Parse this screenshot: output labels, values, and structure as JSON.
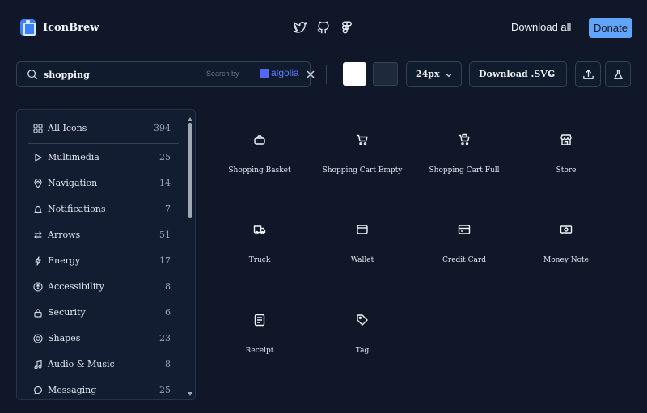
{
  "app": {
    "title": "IconBrew"
  },
  "header": {
    "social": [
      "twitter-icon",
      "github-icon",
      "figma-icon"
    ],
    "download_all_label": "Download all",
    "donate_label": "Donate"
  },
  "search": {
    "value": "shopping",
    "search_by_label": "Search by",
    "provider": "algolia"
  },
  "toolbar": {
    "fg_color": "#ffffff",
    "bg_color": "#1e293b",
    "size_value": "24px",
    "format_value": "Download .SVG"
  },
  "sidebar": {
    "all": {
      "label": "All Icons",
      "count": "394",
      "icon": "grid-icon"
    },
    "items": [
      {
        "label": "Multimedia",
        "count": "25",
        "icon": "play-icon"
      },
      {
        "label": "Navigation",
        "count": "14",
        "icon": "map-pin-icon"
      },
      {
        "label": "Notifications",
        "count": "7",
        "icon": "bell-icon"
      },
      {
        "label": "Arrows",
        "count": "51",
        "icon": "arrows-icon"
      },
      {
        "label": "Energy",
        "count": "17",
        "icon": "bolt-icon"
      },
      {
        "label": "Accessibility",
        "count": "8",
        "icon": "accessibility-icon"
      },
      {
        "label": "Security",
        "count": "6",
        "icon": "lock-icon"
      },
      {
        "label": "Shapes",
        "count": "23",
        "icon": "shapes-icon"
      },
      {
        "label": "Audio & Music",
        "count": "8",
        "icon": "music-icon"
      },
      {
        "label": "Messaging",
        "count": "25",
        "icon": "message-icon"
      }
    ]
  },
  "icons": [
    {
      "label": "Shopping Basket",
      "icon": "shopping-basket-icon"
    },
    {
      "label": "Shopping Cart Empty",
      "icon": "shopping-cart-empty-icon"
    },
    {
      "label": "Shopping Cart Full",
      "icon": "shopping-cart-full-icon"
    },
    {
      "label": "Store",
      "icon": "store-icon"
    },
    {
      "label": "Truck",
      "icon": "truck-icon"
    },
    {
      "label": "Wallet",
      "icon": "wallet-icon"
    },
    {
      "label": "Credit Card",
      "icon": "credit-card-icon"
    },
    {
      "label": "Money Note",
      "icon": "money-note-icon"
    },
    {
      "label": "Receipt",
      "icon": "receipt-icon"
    },
    {
      "label": "Tag",
      "icon": "tag-icon"
    }
  ]
}
